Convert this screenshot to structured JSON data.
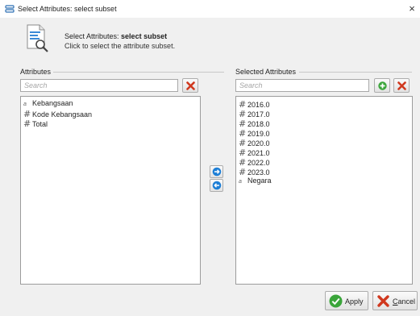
{
  "window": {
    "title": "Select Attributes: select subset",
    "close_glyph": "×"
  },
  "header": {
    "line1_prefix": "Select Attributes: ",
    "line1_bold": "select subset",
    "line2": "Click to select the attribute subset."
  },
  "left_panel": {
    "group_label": "Attributes",
    "search_placeholder": "Search",
    "clear_button_icon": "red-x-icon",
    "items": [
      {
        "label": "Kebangsaan",
        "type": "string"
      },
      {
        "label": "Kode Kebangsaan",
        "type": "numeric"
      },
      {
        "label": "Total",
        "type": "numeric"
      }
    ]
  },
  "right_panel": {
    "group_label": "Selected Attributes",
    "search_placeholder": "Search",
    "add_button_icon": "green-plus-icon",
    "clear_button_icon": "red-x-icon",
    "items": [
      {
        "label": "2016.0",
        "type": "numeric"
      },
      {
        "label": "2017.0",
        "type": "numeric"
      },
      {
        "label": "2018.0",
        "type": "numeric"
      },
      {
        "label": "2019.0",
        "type": "numeric"
      },
      {
        "label": "2020.0",
        "type": "numeric"
      },
      {
        "label": "2021.0",
        "type": "numeric"
      },
      {
        "label": "2022.0",
        "type": "numeric"
      },
      {
        "label": "2023.0",
        "type": "numeric"
      },
      {
        "label": "Negara",
        "type": "string"
      }
    ]
  },
  "type_glyphs": {
    "numeric": "#",
    "string": "a"
  },
  "transfer": {
    "move_right_icon": "arrow-right-icon",
    "move_left_icon": "arrow-left-icon"
  },
  "footer": {
    "apply_label": "Apply",
    "cancel_first": "C",
    "cancel_rest": "ancel"
  },
  "colors": {
    "accent_blue": "#1e7fd6",
    "green": "#3aa53a",
    "red": "#d0381e"
  }
}
